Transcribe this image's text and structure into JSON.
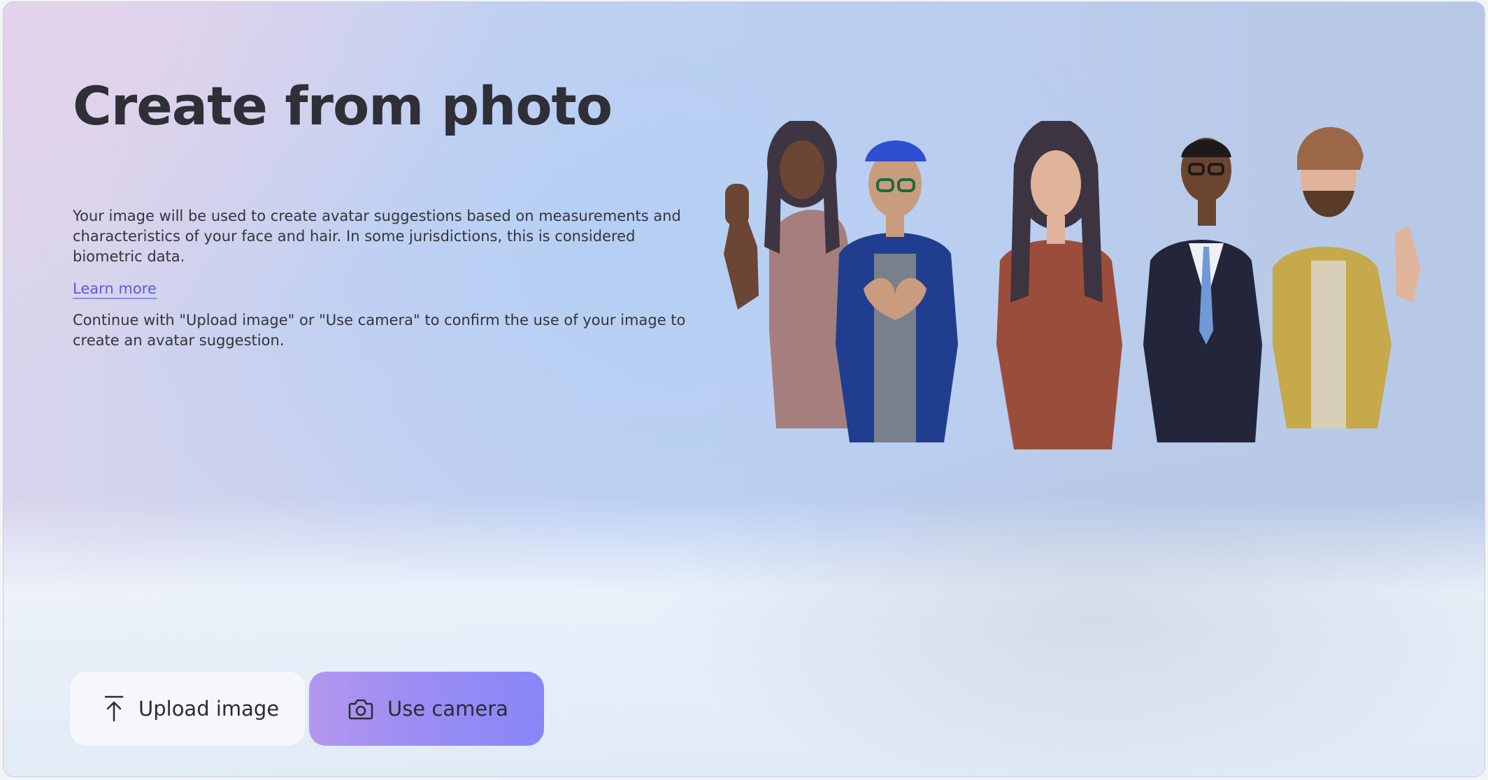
{
  "main": {
    "title": "Create from photo",
    "description": "Your image will be used to create avatar suggestions based on measurements and characteristics of your face and hair. In some jurisdictions, this is considered biometric data.",
    "learn_more_label": "Learn more",
    "confirm_text": "Continue with \"Upload image\" or \"Use camera\" to confirm the use of your image to create an avatar suggestion."
  },
  "actions": {
    "upload_label": "Upload image",
    "upload_icon": "upload-arrow-icon",
    "camera_label": "Use camera",
    "camera_icon": "camera-icon"
  },
  "illustration": {
    "avatar_count": 5
  },
  "colors": {
    "link": "#5b5bd6",
    "camera_button_start": "#b497ee",
    "camera_button_end": "#8887f8",
    "title": "#2f2f37"
  }
}
